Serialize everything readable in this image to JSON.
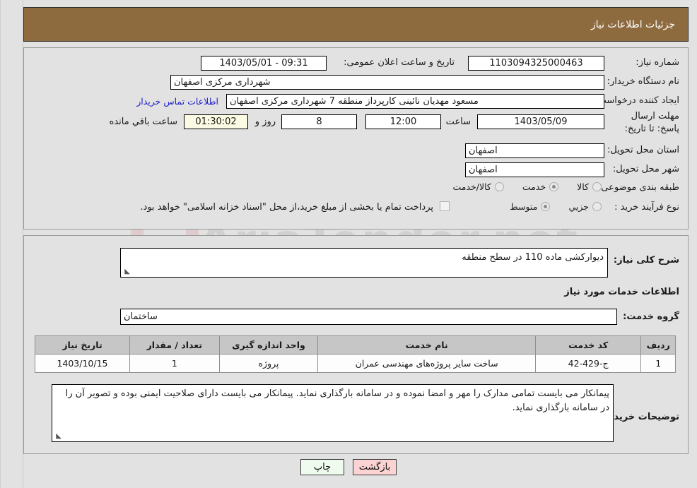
{
  "header": {
    "title": "جزئیات اطلاعات نیاز"
  },
  "watermark": {
    "text": "AriaTender.net"
  },
  "top_form": {
    "need_number": {
      "label": "شماره نیاز:",
      "value": "1103094325000463"
    },
    "announce_datetime": {
      "label": "تاریخ و ساعت اعلان عمومی:",
      "value": "09:31 - 1403/05/01"
    },
    "buyer_org": {
      "label": "نام دستگاه خریدار:",
      "value": "شهرداری مرکزی اصفهان"
    },
    "request_creator": {
      "label": "ایجاد کننده درخواست:",
      "value": "مسعود مهدیان نائینی کارپرداز منطقه 7 شهرداری مرکزی اصفهان"
    },
    "contact_link": "اطلاعات تماس خریدار",
    "deadline": {
      "label": "مهلت ارسال پاسخ: تا تاریخ:",
      "date": "1403/05/09",
      "time_label": "ساعت",
      "time": "12:00",
      "days": "8",
      "days_label": "روز و",
      "countdown": "01:30:02",
      "countdown_label": "ساعت باقي مانده"
    },
    "delivery_province": {
      "label": "استان محل تحویل:",
      "value": "اصفهان"
    },
    "delivery_city": {
      "label": "شهر محل تحویل:",
      "value": "اصفهان"
    },
    "subject_category": {
      "label": "طبقه بندی موضوعی:",
      "options": [
        {
          "label": "کالا",
          "selected": false
        },
        {
          "label": "خدمت",
          "selected": true
        },
        {
          "label": "کالا/خدمت",
          "selected": false
        }
      ]
    },
    "purchase_process": {
      "label": "نوع فرآیند خرید :",
      "options": [
        {
          "label": "جزيي",
          "selected": false
        },
        {
          "label": "متوسط",
          "selected": true
        }
      ],
      "checkbox_note": "پرداخت تمام یا بخشی از مبلغ خرید،از محل \"اسناد خزانه اسلامی\" خواهد بود.",
      "checkbox_checked": false
    }
  },
  "mid": {
    "general_desc": {
      "label": "شرح کلی نیاز:",
      "value": "دیوارکشی ماده 110 در سطح منطقه"
    },
    "services_info_heading": "اطلاعات خدمات مورد نیاز",
    "service_group": {
      "label": "گروه خدمت:",
      "value": "ساختمان"
    },
    "table": {
      "columns": [
        "ردیف",
        "کد خدمت",
        "نام خدمت",
        "واحد اندازه گیری",
        "تعداد / مقدار",
        "تاریخ نیاز"
      ],
      "rows": [
        [
          "1",
          "ج-429-42",
          "ساخت سایر پروژه‌های مهندسی عمران",
          "پروژه",
          "1",
          "1403/10/15"
        ]
      ]
    },
    "buyer_notes": {
      "label": "توضیحات خریدار:",
      "value": "پیمانکار می بایست تمامی مدارک را مهر و امضا نموده و در سامانه بارگذاری نماید. پیمانکار می بایست دارای صلاحیت ایمنی بوده و تصویر آن را در سامانه بارگذاری نماید."
    }
  },
  "footer": {
    "print_button": "چاپ",
    "back_button": "بازگشت"
  },
  "colors": {
    "header_brown": "#8d6b3f",
    "page_bg": "#e2e2e2",
    "link_blue": "#2020cc",
    "back_button_bg": "#fbd3d3",
    "print_button_bg": "#eefbee",
    "countdown_bg": "#fbfbe4",
    "table_header_bg": "#c6c6c6"
  }
}
